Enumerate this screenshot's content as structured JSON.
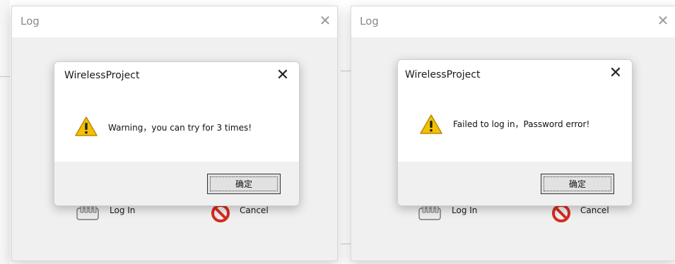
{
  "left": {
    "window_title": "Log",
    "close_glyph": "✕",
    "dialog": {
      "title": "WirelessProject",
      "close_glyph": "✕",
      "message": "Warning，you can try for 3 times!",
      "icon": "warning-icon",
      "ok_label": "确定"
    },
    "login_label": "Log In",
    "cancel_label": "Cancel"
  },
  "right": {
    "window_title": "Log",
    "close_glyph": "✕",
    "dialog": {
      "title": "WirelessProject",
      "close_glyph": "✕",
      "message": "Failed to log in，Password error!",
      "icon": "warning-icon",
      "ok_label": "确定"
    },
    "login_label": "Log In",
    "cancel_label": "Cancel"
  },
  "colors": {
    "window_bg": "#f0f0f0",
    "title_bg": "#ffffff",
    "cancel_red": "#d62b1f",
    "warning_yellow": "#f5c000"
  }
}
